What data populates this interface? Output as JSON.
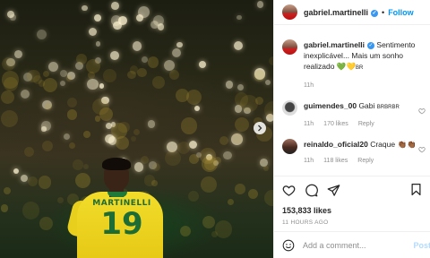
{
  "post": {
    "username": "gabriel.martinelli",
    "follow_label": "Follow",
    "separator": "•",
    "caption_text": "Sentimento inexplicável... Mais um sonho realizado",
    "caption_emojis": "💚💛",
    "caption_suffix": "BR",
    "caption_time": "11h"
  },
  "photo": {
    "jersey_name": "MARTINELLI",
    "jersey_number": "19"
  },
  "comments": [
    {
      "username": "guimendes_00",
      "text": "Gabi",
      "suffix": "BRBRBR",
      "time": "11h",
      "likes": "170 likes",
      "reply_label": "Reply"
    },
    {
      "username": "reinaldo_oficial20",
      "text": "Craque",
      "emojis": "👏🏾👏🏾",
      "time": "11h",
      "likes": "118 likes",
      "reply_label": "Reply"
    }
  ],
  "stats": {
    "likes": "153,833 likes",
    "ago": "11 HOURS AGO"
  },
  "composer": {
    "placeholder": "Add a comment...",
    "post_label": "Post"
  },
  "colors": {
    "accent": "#0095f6",
    "verified": "#3897f0",
    "muted": "#8e8e8e",
    "jersey": "#f2dc2a"
  }
}
